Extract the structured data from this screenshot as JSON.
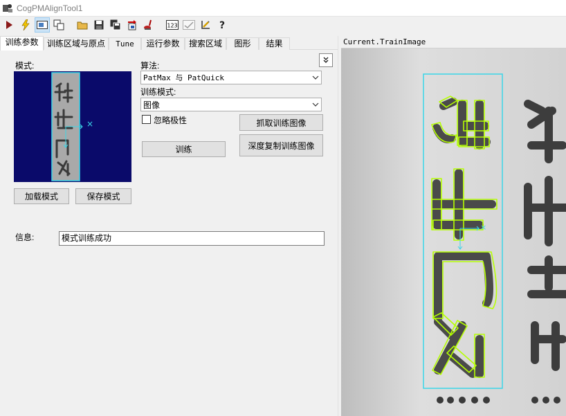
{
  "window": {
    "title": "CogPMAlignTool1"
  },
  "toolbar": {
    "buttons": [
      {
        "icon": "run-icon",
        "active": false
      },
      {
        "icon": "electric-icon",
        "active": false
      },
      {
        "icon": "display-icon",
        "active": true
      },
      {
        "icon": "windows-icon",
        "active": false
      },
      {
        "icon": "open-folder-icon",
        "active": false
      },
      {
        "icon": "save-icon",
        "active": false
      },
      {
        "icon": "save-as-icon",
        "active": false
      },
      {
        "icon": "import-icon",
        "active": false
      },
      {
        "icon": "tool-icon",
        "active": false
      },
      {
        "icon": "numeric-123-icon",
        "active": false
      },
      {
        "icon": "checkmark-graph-icon",
        "active": false
      },
      {
        "icon": "edit-measure-icon",
        "active": false
      },
      {
        "icon": "help-icon",
        "active": false
      }
    ]
  },
  "tabs": [
    {
      "label": "训练参数",
      "active": true
    },
    {
      "label": "训练区域与原点",
      "active": false
    },
    {
      "label": "Tune",
      "active": false
    },
    {
      "label": "运行参数",
      "active": false
    },
    {
      "label": "搜索区域",
      "active": false
    },
    {
      "label": "图形",
      "active": false
    },
    {
      "label": "结果",
      "active": false
    }
  ],
  "train_params": {
    "pattern_label": "模式:",
    "algorithm_label": "算法:",
    "algorithm_value": "PatMax 与 PatQuick",
    "train_mode_label": "训练模式:",
    "train_mode_value": "图像",
    "ignore_polarity_label": "忽略极性",
    "ignore_polarity_checked": false,
    "grab_train_image_button": "抓取训练图像",
    "train_button": "训练",
    "deep_copy_button": "深度复制训练图像",
    "load_pattern_button": "加载模式",
    "save_pattern_button": "保存模式",
    "info_label": "信息:",
    "info_value": "模式训练成功",
    "collapse_icon": "chevron-down-double-icon"
  },
  "image_view": {
    "title": "Current.TrainImage"
  },
  "colors": {
    "pattern_background": "#0a0a6a",
    "roi_box": "#3ad6e8",
    "feature_edges": "#b5ff00",
    "active_tab_bg": "#ffffff",
    "toolbar_active": "#cce4f7"
  }
}
